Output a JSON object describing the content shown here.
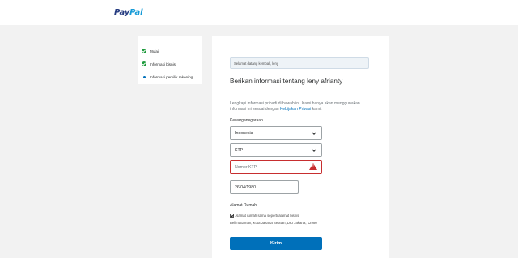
{
  "brand": {
    "pay": "Pay",
    "pal": "Pal"
  },
  "steps": [
    {
      "label": "Mulai",
      "status": "done"
    },
    {
      "label": "Informasi bisnis",
      "status": "done"
    },
    {
      "label": "Informasi pemilik rekening",
      "status": "current"
    }
  ],
  "form": {
    "welcome": "Selamat datang kembali, leny",
    "heading": "Berikan informasi tentang leny afrianty",
    "intro_text": "Lengkapi informasi pribadi di bawah ini. Kami hanya akan menggunakan informasi ini sesuai dengan ",
    "intro_link": "Kebijakan Privasi",
    "intro_suffix": " kami.",
    "nationality_label": "Kewarganegaraan",
    "nationality_value": "Indonesia",
    "id_type_value": "KTP",
    "id_number_placeholder": "Nomor KTP",
    "dob_value": "26/04/1980",
    "address_label": "Alamat Rumah",
    "same_address_label": "Alamat rumah sama seperti alamat bisnis",
    "address_value": "Belimattaman, Kota Jakarta Selatan, DKI Jakarta, 12980",
    "submit_label": "Kirim"
  },
  "colors": {
    "primary": "#0070ba",
    "error": "#c72e2f",
    "success": "#1e9b3d"
  }
}
